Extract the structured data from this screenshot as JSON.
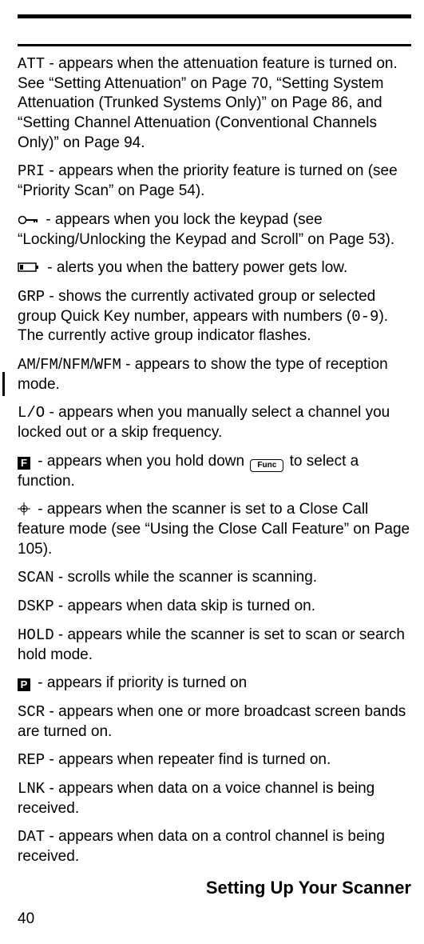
{
  "entries": [
    {
      "code": "ATT",
      "code_class": "mono",
      "text": " - appears when the attenuation feature is turned on. See “Setting Attenuation” on Page 70, “Setting System Attenuation (Trunked Systems Only)” on Page 86, and “Setting Channel Attenuation (Conventional Channels Only)” on Page 94."
    },
    {
      "code": "PRI",
      "code_class": "mono",
      "text": " - appears when the priority feature is turned on (see “Priority Scan” on Page 54)."
    },
    {
      "icon": "key",
      "text": " - appears when you lock the keypad (see “Locking/Unlocking the Keypad and Scroll” on Page 53)."
    },
    {
      "icon": "battery",
      "text": " - alerts you when the battery power gets low."
    },
    {
      "code": "GRP",
      "code_class": "mono",
      "text_pre": " - shows the currently activated group or selected group Quick Key number, appears with numbers (",
      "range": "0-9",
      "text_post": "). The currently active group indicator flashes."
    },
    {
      "modes": [
        "AM",
        "FM",
        "NFM",
        "WFM"
      ],
      "text": " - appears to show the type of reception mode.",
      "change_bar": true
    },
    {
      "code": "L/O",
      "code_class": "mono",
      "text": " - appears when you manually select a channel you locked out or a skip frequency."
    },
    {
      "icon": "f-box",
      "text_pre": " - appears when you hold down ",
      "func_label": "Func",
      "text_post": " to select a function."
    },
    {
      "icon": "closecall",
      "text": " - appears when the scanner is set to a Close Call feature mode (see “Using the Close Call Feature” on Page 105)."
    },
    {
      "code": "SCAN",
      "code_class": "mono",
      "text": " - scrolls while the scanner is scanning."
    },
    {
      "code": "DSKP",
      "code_class": "mono",
      "text": " - appears when data skip is turned on."
    },
    {
      "code": "HOLD",
      "code_class": "mono",
      "text": " - appears while the scanner is set to scan or search hold mode."
    },
    {
      "icon": "p-box",
      "text": " - appears if priority is turned on"
    },
    {
      "code": "SCR",
      "code_class": "mono",
      "text": " - appears when one or more broadcast screen bands are turned on."
    },
    {
      "code": "REP",
      "code_class": "mono",
      "text": " - appears when repeater find is turned on."
    },
    {
      "code": "LNK",
      "code_class": "mono",
      "text": " - appears when data on a voice channel is being received."
    },
    {
      "code": "DAT",
      "code_class": "mono",
      "text": " - appears when data on a control channel is being received."
    }
  ],
  "footer": {
    "title": "Setting Up Your Scanner",
    "page": "40"
  }
}
